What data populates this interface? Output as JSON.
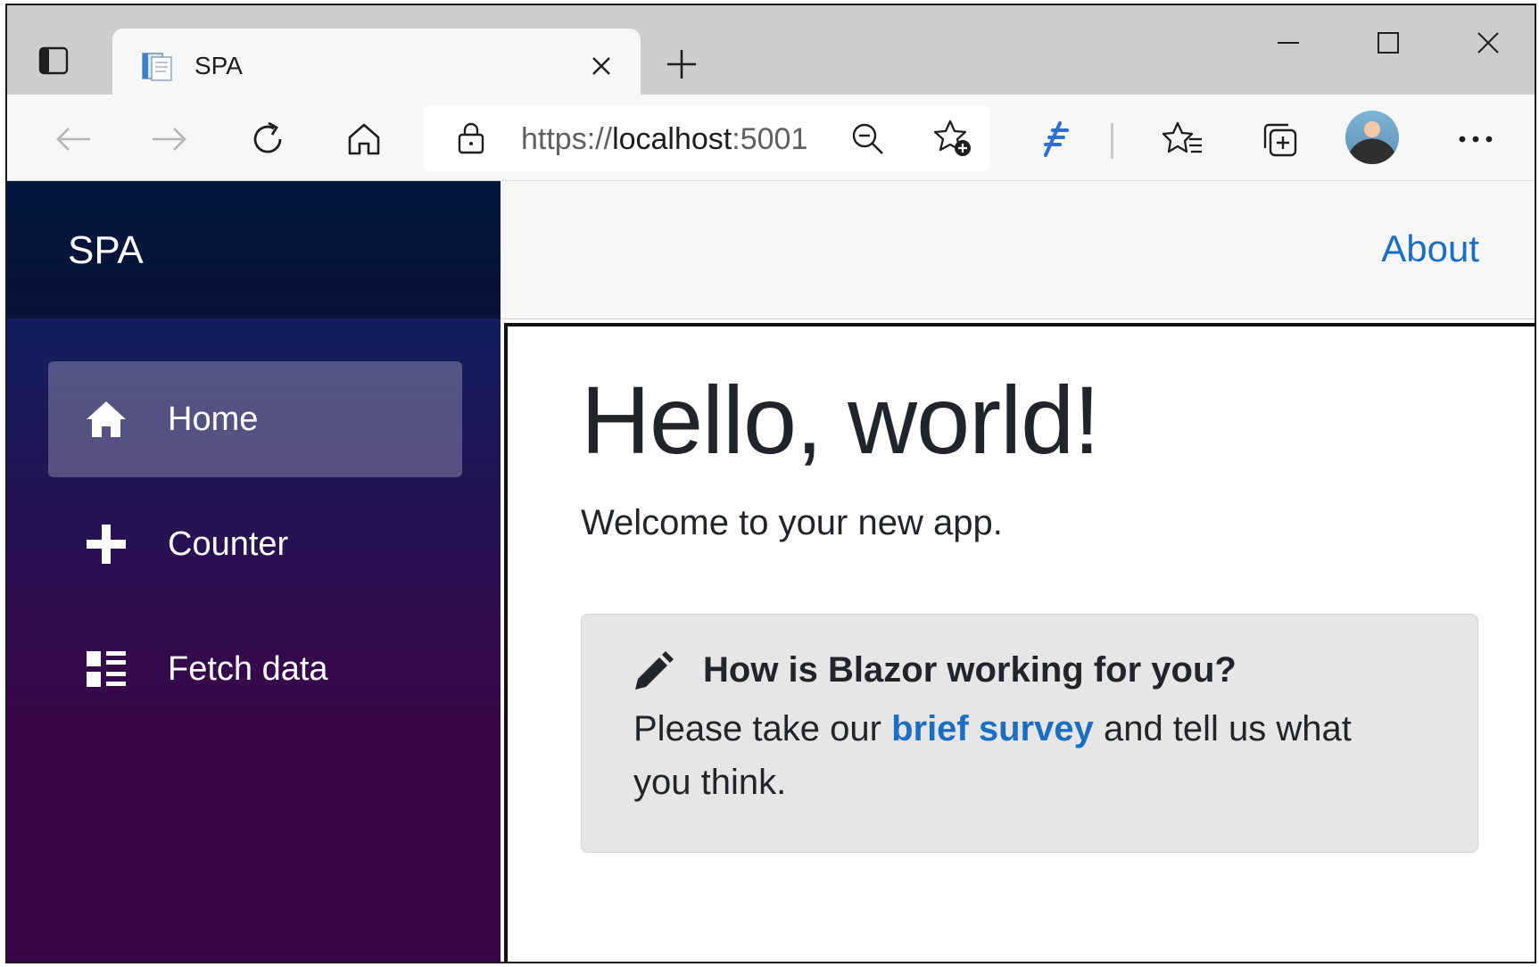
{
  "browser": {
    "tab": {
      "title": "SPA",
      "favicon": "page-icon"
    },
    "new_tab_icon": "plus-icon",
    "window_controls": [
      "minimize-icon",
      "maximize-icon",
      "close-icon"
    ],
    "address_bar": {
      "scheme": "https://",
      "host": "localhost",
      "port": ":5001"
    },
    "toolbar_icons": [
      "back-icon",
      "forward-icon",
      "refresh-icon",
      "home-icon",
      "zoom-out-icon",
      "add-favorite-icon",
      "extension-icon",
      "favorites-icon",
      "collections-icon",
      "profile-avatar",
      "more-icon"
    ]
  },
  "app": {
    "brand": "SPA",
    "nav": [
      {
        "label": "Home",
        "icon": "home-icon",
        "active": true
      },
      {
        "label": "Counter",
        "icon": "plus-icon",
        "active": false
      },
      {
        "label": "Fetch data",
        "icon": "list-rich-icon",
        "active": false
      }
    ],
    "top_link": "About",
    "page": {
      "heading": "Hello, world!",
      "welcome": "Welcome to your new app.",
      "survey": {
        "icon": "pencil-icon",
        "title": "How is Blazor working for you?",
        "text_before": "Please take our ",
        "link": "brief survey",
        "text_after": " and tell us what you think."
      }
    }
  },
  "colors": {
    "sidebar_top": "#052767",
    "sidebar_bottom": "#3a0647",
    "link": "#1b6ec2",
    "text": "#212529"
  }
}
